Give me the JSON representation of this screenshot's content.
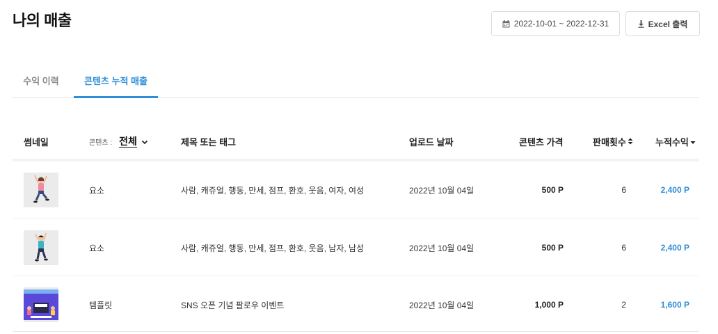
{
  "page": {
    "title": "나의 매출"
  },
  "toolbar": {
    "date_range": "2022-10-01 ~ 2022-12-31",
    "excel_label": "Excel 출력"
  },
  "tabs": [
    {
      "label": "수익 이력",
      "active": false
    },
    {
      "label": "콘텐츠 누적 매출",
      "active": true
    }
  ],
  "table": {
    "headers": {
      "thumbnail": "썸네일",
      "filter_label": "콘텐츠 :",
      "filter_value": "전체",
      "title_tags": "제목 또는 태그",
      "upload_date": "업로드 날짜",
      "price": "콘텐츠 가격",
      "sales_count": "판매횟수",
      "revenue": "누적수익"
    },
    "rows": [
      {
        "type": "요소",
        "title": "사람, 캐쥬얼, 행동, 만세, 점프, 환호, 웃음, 여자, 여성",
        "date": "2022년 10월 04일",
        "price": "500 P",
        "count": "6",
        "revenue": "2,400 P",
        "thumb": "woman-jumping"
      },
      {
        "type": "요소",
        "title": "사람, 캐쥬얼, 행동, 만세, 점프, 환호, 웃음, 남자, 남성",
        "date": "2022년 10월 04일",
        "price": "500 P",
        "count": "6",
        "revenue": "2,400 P",
        "thumb": "man-jumping"
      },
      {
        "type": "템플릿",
        "title": "SNS 오픈 기념 팔로우 이벤트",
        "date": "2022년 10월 04일",
        "price": "1,000 P",
        "count": "2",
        "revenue": "1,600 P",
        "thumb": "event-template"
      }
    ]
  },
  "colors": {
    "accent": "#2f8fd8",
    "border": "#e6e6e6",
    "muted": "#8a8a8a"
  }
}
